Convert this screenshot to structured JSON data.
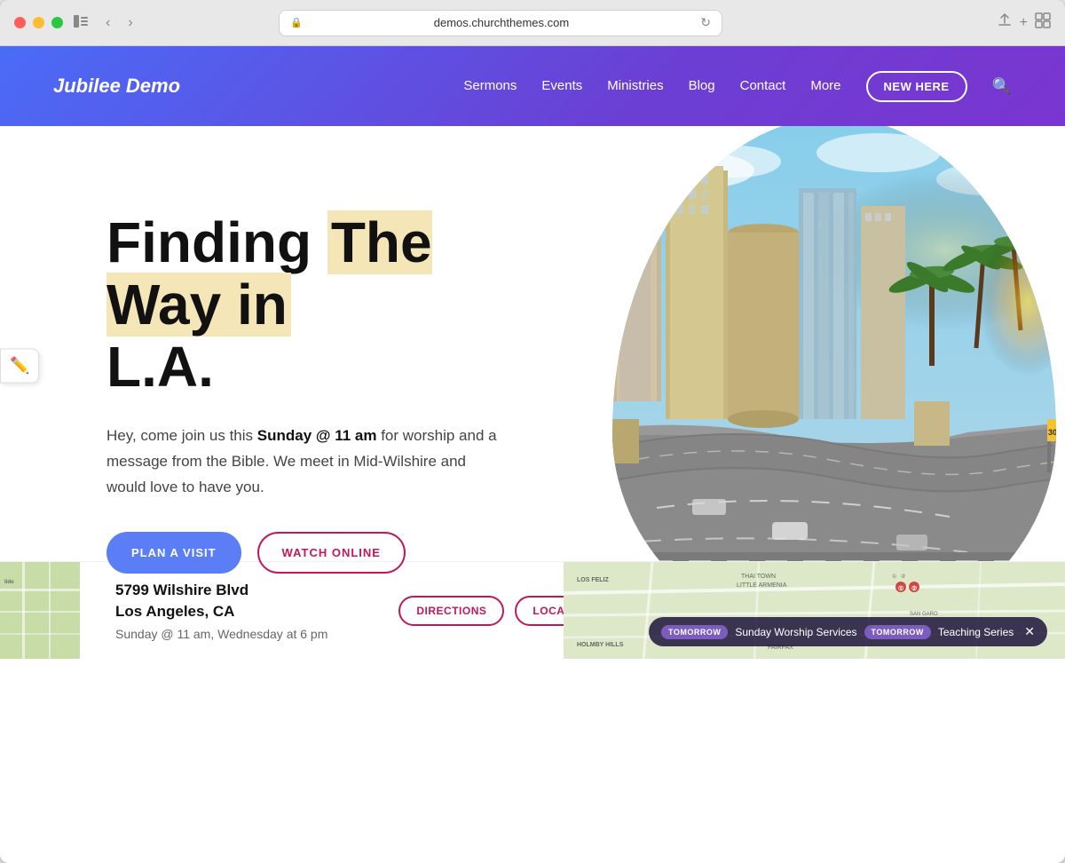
{
  "browser": {
    "url": "demos.churchthemes.com",
    "back_label": "‹",
    "forward_label": "›"
  },
  "nav": {
    "logo": "Jubilee Demo",
    "links": [
      "Sermons",
      "Events",
      "Ministries",
      "Blog",
      "Contact",
      "More"
    ],
    "cta_button": "NEW HERE",
    "search_icon": "🔍"
  },
  "hero": {
    "title_line1": "Finding The Way in",
    "title_line2": "L.A.",
    "highlight_word": "The Way in",
    "description": "Hey, come join us this",
    "description_bold1": "Sunday @ 11 am",
    "description_middle": " for worship and a message from the Bible. We meet in Mid-Wilshire and would love to have you.",
    "btn_primary": "PLAN A VISIT",
    "btn_secondary": "WATCH ONLINE"
  },
  "footer": {
    "address_line1": "5799 Wilshire Blvd",
    "address_line2": "Los Angeles, CA",
    "schedule": "Sunday @ 11 am, Wednesday at 6 pm",
    "btn_directions": "DIRECTIONS",
    "btn_locations": "LOCATIONS"
  },
  "notification": {
    "badge1": "TOMORROW",
    "event1": "Sunday Worship Services",
    "badge2": "TOMORROW",
    "event2": "Teaching Series"
  },
  "colors": {
    "nav_gradient_start": "#4a6cf7",
    "nav_gradient_end": "#7b35d0",
    "primary_btn": "#5b7ef7",
    "secondary_btn_border": "#c2185b",
    "highlight_bg": "#f5e6b8",
    "notification_badge": "#7c5cbf"
  }
}
